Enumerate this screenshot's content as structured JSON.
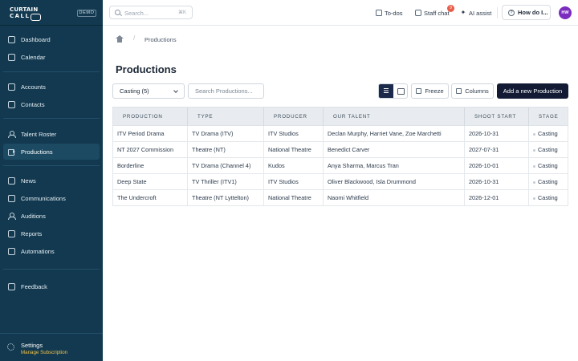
{
  "brand": {
    "line1": "CURTAIN",
    "line2": "CALL",
    "env_badge": "DEMO"
  },
  "sidebar": {
    "items": [
      {
        "label": "Dashboard",
        "icon": "dashboard-icon"
      },
      {
        "label": "Calendar",
        "icon": "calendar-icon"
      },
      {
        "label": "Accounts",
        "icon": "accounts-icon"
      },
      {
        "label": "Contacts",
        "icon": "contacts-icon"
      },
      {
        "label": "Talent Roster",
        "icon": "person-icon"
      },
      {
        "label": "Productions",
        "icon": "film-icon",
        "active": true
      },
      {
        "label": "News",
        "icon": "news-icon"
      },
      {
        "label": "Communications",
        "icon": "communications-icon"
      },
      {
        "label": "Auditions",
        "icon": "auditions-icon"
      },
      {
        "label": "Reports",
        "icon": "reports-icon"
      },
      {
        "label": "Automations",
        "icon": "automations-icon"
      },
      {
        "label": "Feedback",
        "icon": "feedback-icon"
      }
    ],
    "settings_label": "Settings",
    "subscription_label": "Manage Subscription"
  },
  "topbar": {
    "search_placeholder": "Search...",
    "search_shortcut": "⌘K",
    "todos_label": "To-dos",
    "staff_chat_label": "Staff chat",
    "staff_chat_count": "9",
    "ai_assist_label": "AI assist",
    "help_label": "How do I...",
    "avatar_initials": "HW"
  },
  "breadcrumb": {
    "current": "Productions"
  },
  "page": {
    "title": "Productions"
  },
  "toolbar": {
    "filter_value": "Casting (5)",
    "search_placeholder": "Search Productions...",
    "freeze_label": "Freeze",
    "columns_label": "Columns",
    "add_label": "Add a new Production"
  },
  "table": {
    "headers": [
      "PRODUCTION",
      "TYPE",
      "PRODUCER",
      "OUR TALENT",
      "SHOOT START",
      "STAGE"
    ],
    "rows": [
      {
        "production": "ITV Period Drama",
        "type": "TV Drama (ITV)",
        "producer": "ITV Studios",
        "talent": "Declan Murphy, Harriet Vane, Zoe Marchetti",
        "shoot_start": "2026-10-31",
        "stage": "Casting"
      },
      {
        "production": "NT 2027 Commission",
        "type": "Theatre (NT)",
        "producer": "National Theatre",
        "talent": "Benedict Carver",
        "shoot_start": "2027-07-31",
        "stage": "Casting"
      },
      {
        "production": "Borderline",
        "type": "TV Drama (Channel 4)",
        "producer": "Kudos",
        "talent": "Anya Sharma, Marcus Tran",
        "shoot_start": "2026-10-01",
        "stage": "Casting"
      },
      {
        "production": "Deep State",
        "type": "TV Thriller (ITV1)",
        "producer": "ITV Studios",
        "talent": "Oliver Blackwood, Isla Drummond",
        "shoot_start": "2026-10-31",
        "stage": "Casting"
      },
      {
        "production": "The Undercroft",
        "type": "Theatre (NT Lyttelton)",
        "producer": "National Theatre",
        "talent": "Naomi Whitfield",
        "shoot_start": "2026-12-01",
        "stage": "Casting"
      }
    ]
  },
  "colors": {
    "sidebar_bg": "#12394f",
    "primary": "#121b33",
    "avatar": "#7b2cbf",
    "badge": "#e85d4a",
    "subscription_link": "#f0c24a"
  }
}
